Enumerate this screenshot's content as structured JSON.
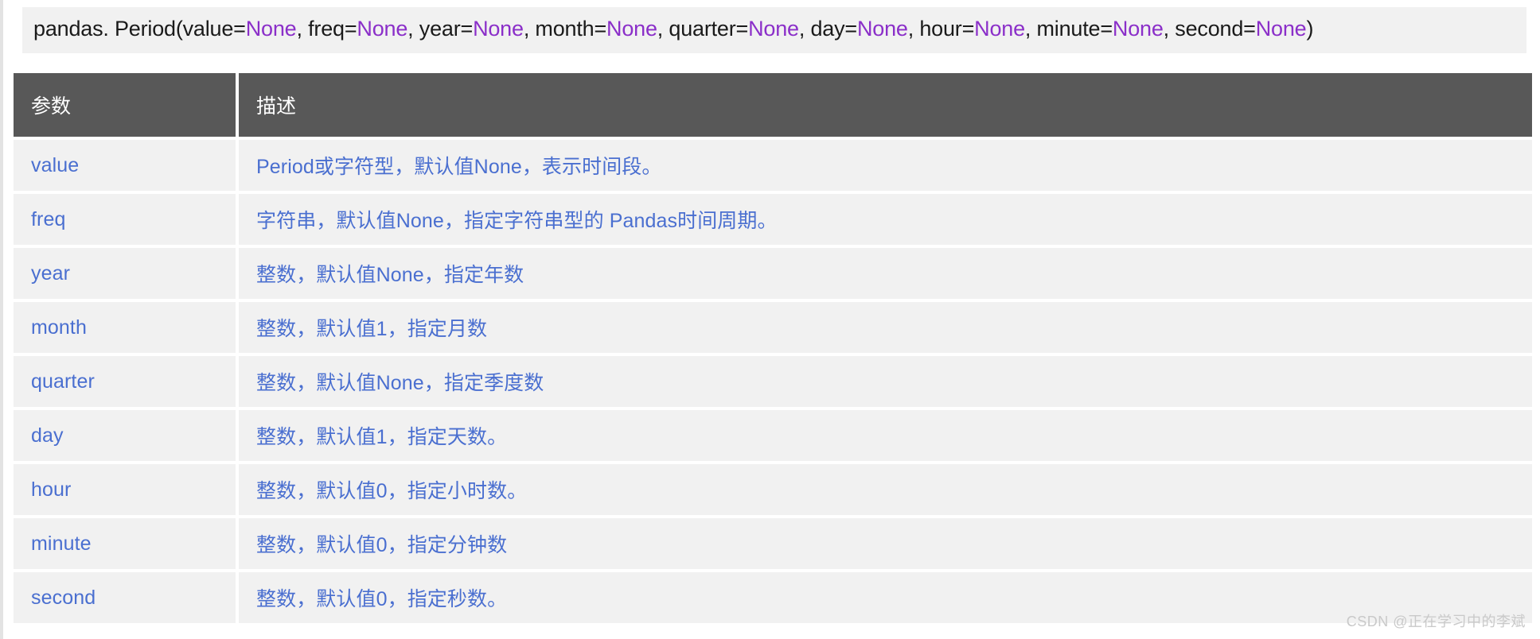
{
  "signature": {
    "prefix": "pandas. Period(",
    "suffix": ")",
    "none_literal": "None",
    "full_text": "pandas. Period(value=None, freq=None, year=None, month=None, quarter=None, day=None, hour=None, minute=None, second=None)",
    "params": [
      {
        "name": "value=",
        "value": "None",
        "sep": ", "
      },
      {
        "name": "freq=",
        "value": "None",
        "sep": ", "
      },
      {
        "name": "year=",
        "value": "None",
        "sep": ", "
      },
      {
        "name": "month=",
        "value": "None",
        "sep": ", "
      },
      {
        "name": "quarter=",
        "value": "None",
        "sep": ", "
      },
      {
        "name": "day=",
        "value": "None",
        "sep": ", "
      },
      {
        "name": "hour=",
        "value": "None",
        "sep": ", "
      },
      {
        "name": "minute=",
        "value": "None",
        "sep": ", "
      },
      {
        "name": "second=",
        "value": "None",
        "sep": ""
      }
    ]
  },
  "table": {
    "headers": [
      "参数",
      "描述"
    ],
    "rows": [
      {
        "param": "value",
        "desc": "Period或字符型，默认值None，表示时间段。"
      },
      {
        "param": "freq",
        "desc": "字符串，默认值None，指定字符串型的 Pandas时间周期。"
      },
      {
        "param": "year",
        "desc": "整数，默认值None，指定年数"
      },
      {
        "param": "month",
        "desc": "整数，默认值1，指定月数"
      },
      {
        "param": "quarter",
        "desc": "整数，默认值None，指定季度数"
      },
      {
        "param": "day",
        "desc": "整数，默认值1，指定天数。"
      },
      {
        "param": "hour",
        "desc": "整数，默认值0，指定小时数。"
      },
      {
        "param": "minute",
        "desc": "整数，默认值0，指定分钟数"
      },
      {
        "param": "second",
        "desc": "整数，默认值0，指定秒数。"
      }
    ]
  },
  "watermark": {
    "text": "CSDN @正在学习中的李斌"
  },
  "colors": {
    "header_bg": "#585858",
    "row_bg": "#f1f1f1",
    "cell_text": "#4a6fd0",
    "none_literal": "#8b2fc9",
    "signature_bg": "#f1f1f1",
    "signature_text": "#1a1a1a",
    "watermark_text": "#c9c9c9",
    "page_bg": "#ffffff"
  }
}
